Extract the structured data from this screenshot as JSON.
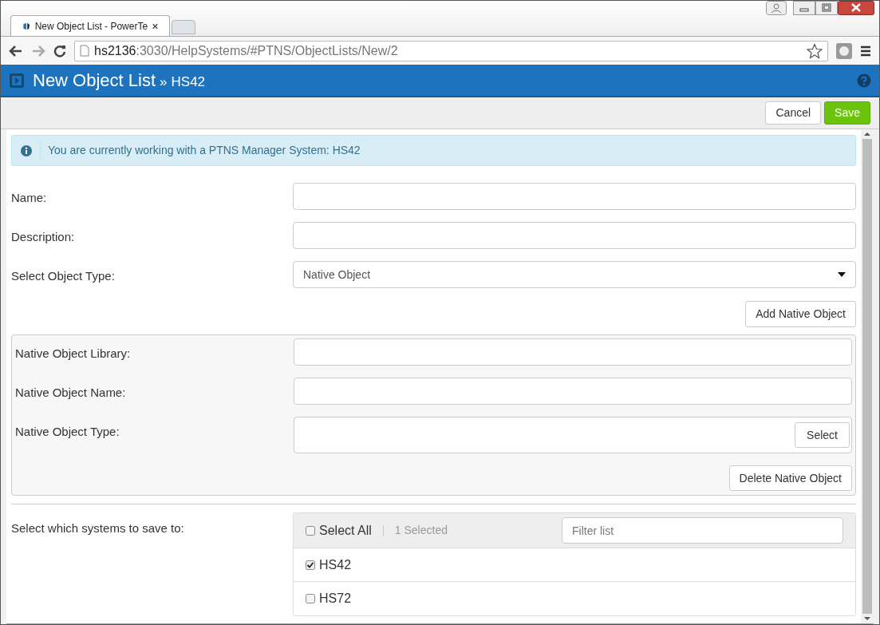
{
  "browser": {
    "tab_title": "New Object List - PowerTe",
    "url_host": "hs2136",
    "url_path": ":3030/HelpSystems/#PTNS/ObjectLists/New/2"
  },
  "header": {
    "title": "New Object List",
    "separator": "»",
    "subtitle": "HS42"
  },
  "toolbar": {
    "buttons": [
      {
        "label": "Cancel",
        "kind": "default"
      },
      {
        "label": "Save",
        "kind": "primary"
      }
    ]
  },
  "alert": "You are currently working with a PTNS Manager System: HS42",
  "fields": [
    {
      "label": "Name:",
      "kind": "text"
    },
    {
      "label": "Description:",
      "kind": "text"
    },
    {
      "label": "Select Object Type:",
      "kind": "select",
      "value": "Native Object"
    }
  ],
  "add_button": "Add Native Object",
  "native_object": {
    "fields": [
      {
        "label": "Native Object Library:",
        "kind": "text"
      },
      {
        "label": "Native Object Name:",
        "kind": "text"
      },
      {
        "label": "Native Object Type:",
        "kind": "picker",
        "button": "Select"
      }
    ],
    "delete_button": "Delete Native Object"
  },
  "systems": {
    "label": "Select which systems to save to:",
    "select_all": {
      "label": "Select All",
      "checked": false
    },
    "selected_count": "1 Selected",
    "filter": {
      "placeholder": "Filter list"
    },
    "items": [
      {
        "label": "HS42",
        "checked": true
      },
      {
        "label": "HS72",
        "checked": false
      }
    ]
  }
}
